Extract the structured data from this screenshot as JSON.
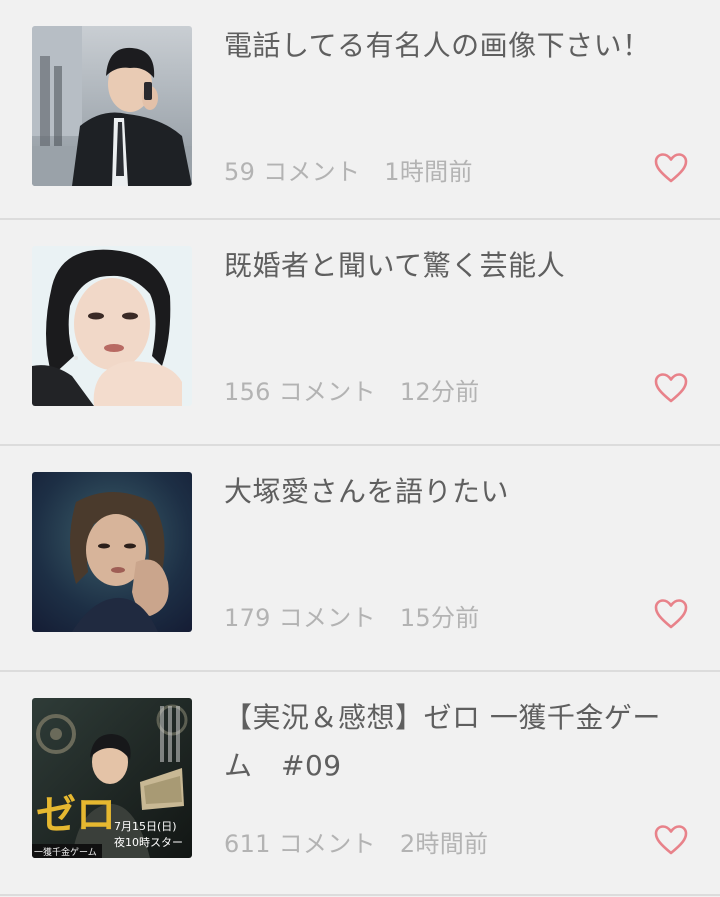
{
  "colors": {
    "background": "#f1f1f1",
    "divider": "#dcdcdc",
    "title_text": "#5f5f5f",
    "meta_text": "#b3b3b3",
    "heart": "#e8828a"
  },
  "topics": [
    {
      "title": "電話してる有名人の画像下さい！",
      "comments": "59 コメント",
      "time": "1時間前",
      "thumbnail": "man-on-phone-photo",
      "icon": "heart-outline-icon"
    },
    {
      "title": "既婚者と聞いて驚く芸能人",
      "comments": "156 コメント",
      "time": "12分前",
      "thumbnail": "woman-portrait-photo",
      "icon": "heart-outline-icon"
    },
    {
      "title": "大塚愛さんを語りたい",
      "comments": "179 コメント",
      "time": "15分前",
      "thumbnail": "woman-dark-portrait-photo",
      "icon": "heart-outline-icon"
    },
    {
      "title": "【実況＆感想】ゼロ 一獲千金ゲーム　#09",
      "comments": "611 コメント",
      "time": "2時間前",
      "thumbnail": "drama-poster",
      "icon": "heart-outline-icon",
      "poster_text": {
        "logo": "ゼロ",
        "subtitle": "一獲千金ゲーム",
        "date": "7月15日(日)",
        "slot": "夜10時スター"
      }
    }
  ]
}
